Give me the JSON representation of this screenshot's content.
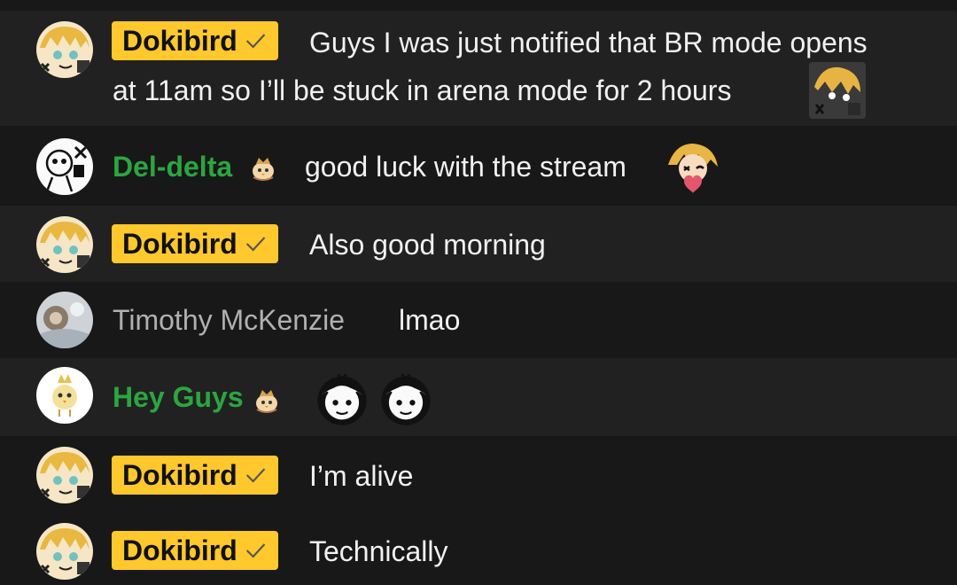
{
  "messages": [
    {
      "author": "Dokibird",
      "role": "owner",
      "text_line1": "Guys I was just notified that BR mode opens",
      "text_line2": "at 11am so I’ll be stuck in arena mode for 2 hours"
    },
    {
      "author": "Del-delta",
      "role": "member",
      "text": "good luck with the stream"
    },
    {
      "author": "Dokibird",
      "role": "owner",
      "text": "Also good morning"
    },
    {
      "author": "Timothy McKenzie",
      "role": "viewer",
      "text": "lmao"
    },
    {
      "author": "Hey Guys",
      "role": "member",
      "text": ""
    },
    {
      "author": "Dokibird",
      "role": "owner",
      "text": "I’m alive"
    },
    {
      "author": "Dokibird",
      "role": "owner",
      "text": "Technically"
    }
  ],
  "colors": {
    "background": "#181818",
    "row_alt": "#212121",
    "owner_badge": "#ffc82c",
    "member_name": "#2ba640",
    "viewer_name": "#b0b0b0"
  },
  "icons": {
    "owner_check": "checkmark-icon",
    "member_badge": "chick-member-badge-icon",
    "emote": "dokibird-emote-icon"
  }
}
